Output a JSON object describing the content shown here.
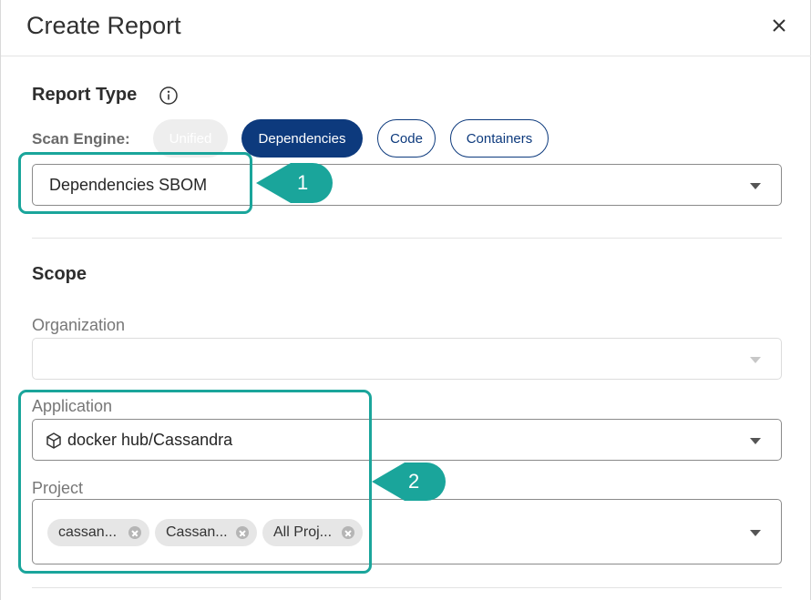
{
  "dialog": {
    "title": "Create Report"
  },
  "report_type": {
    "heading": "Report Type",
    "scan_engine_label": "Scan Engine:",
    "engines": [
      {
        "label": "Unified",
        "state": "disabled"
      },
      {
        "label": "Dependencies",
        "state": "selected"
      },
      {
        "label": "Code",
        "state": "default"
      },
      {
        "label": "Containers",
        "state": "default"
      }
    ],
    "report_select_value": "Dependencies SBOM"
  },
  "scope": {
    "heading": "Scope",
    "organization_label": "Organization",
    "organization_value": "",
    "application_label": "Application",
    "application_value": "docker hub/Cassandra",
    "application_icon": "cube-icon",
    "project_label": "Project",
    "project_tags": [
      "cassan...",
      "Cassan...",
      "All Proj..."
    ]
  },
  "callouts": [
    "1",
    "2"
  ],
  "colors": {
    "accent_teal": "#1aa59b",
    "primary_navy": "#0d3a7d"
  }
}
